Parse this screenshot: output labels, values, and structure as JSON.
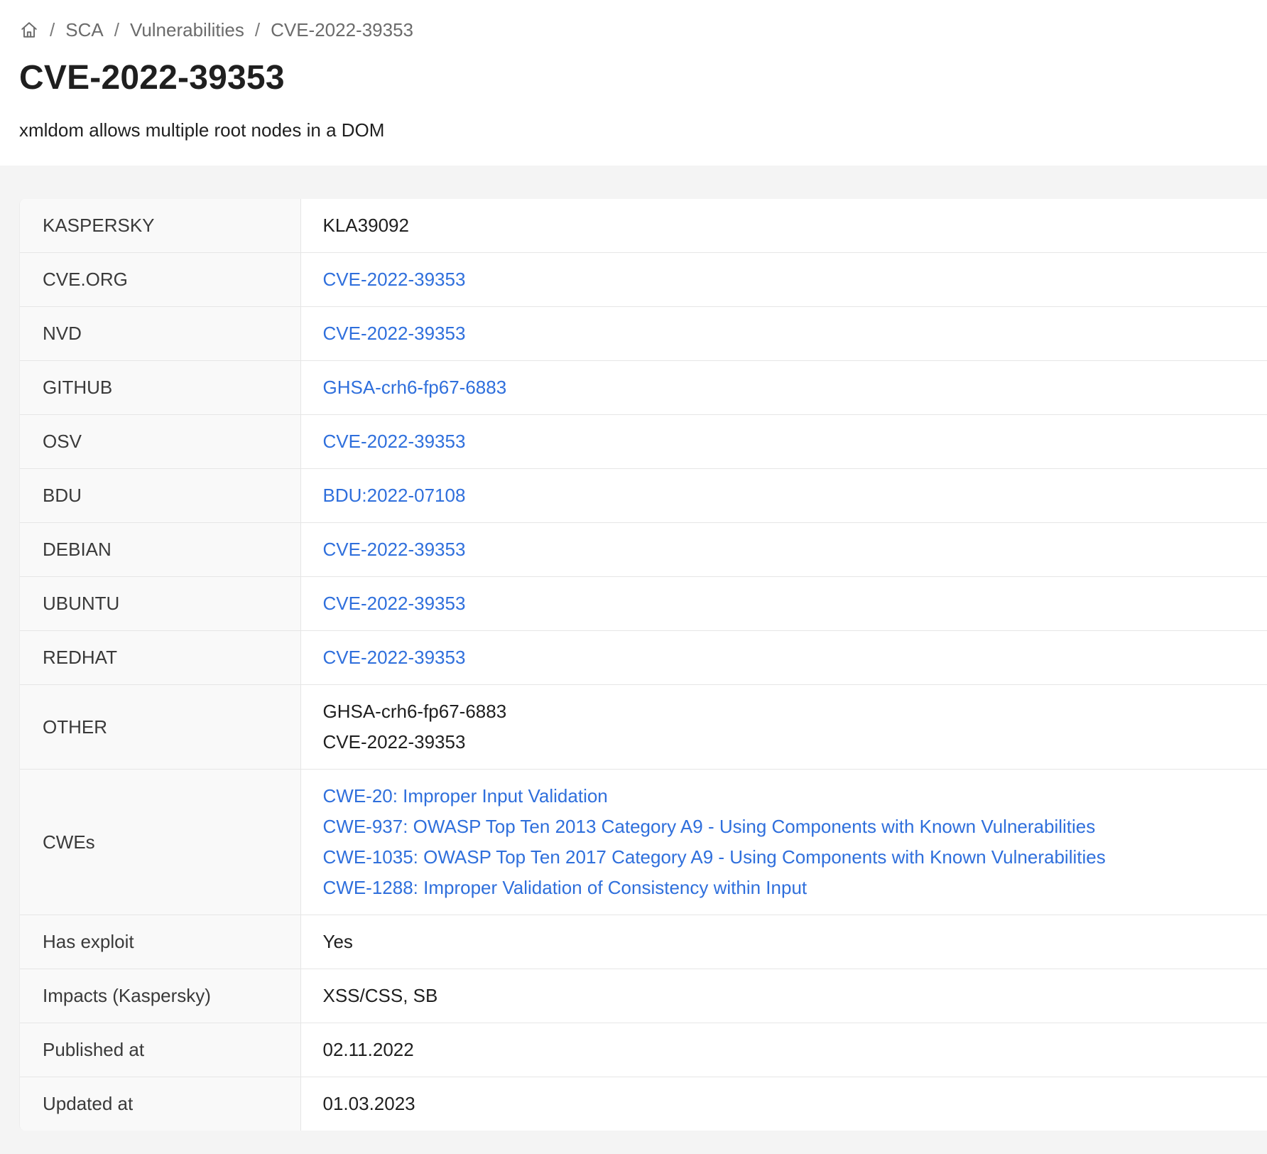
{
  "breadcrumb": {
    "home_icon": "home-icon",
    "items": [
      "SCA",
      "Vulnerabilities",
      "CVE-2022-39353"
    ],
    "separator": "/"
  },
  "title": "CVE-2022-39353",
  "subtitle": "xmldom allows multiple root nodes in a DOM",
  "colors": {
    "link": "#2f6fdc",
    "label_bg": "#f9f9f9",
    "page_bg": "#f4f4f4"
  },
  "rows": {
    "kaspersky": {
      "label": "KASPERSKY",
      "value": "KLA39092"
    },
    "cve_org": {
      "label": "CVE.ORG",
      "value": "CVE-2022-39353"
    },
    "nvd": {
      "label": "NVD",
      "value": "CVE-2022-39353"
    },
    "github": {
      "label": "GITHUB",
      "value": "GHSA-crh6-fp67-6883"
    },
    "osv": {
      "label": "OSV",
      "value": "CVE-2022-39353"
    },
    "bdu": {
      "label": "BDU",
      "value": "BDU:2022-07108"
    },
    "debian": {
      "label": "DEBIAN",
      "value": "CVE-2022-39353"
    },
    "ubuntu": {
      "label": "UBUNTU",
      "value": "CVE-2022-39353"
    },
    "redhat": {
      "label": "REDHAT",
      "value": "CVE-2022-39353"
    },
    "other": {
      "label": "OTHER",
      "values": [
        "GHSA-crh6-fp67-6883",
        "CVE-2022-39353"
      ]
    },
    "cwes": {
      "label": "CWEs",
      "values": [
        "CWE-20: Improper Input Validation",
        "CWE-937: OWASP Top Ten 2013 Category A9 - Using Components with Known Vulnerabilities",
        "CWE-1035: OWASP Top Ten 2017 Category A9 - Using Components with Known Vulnerabilities",
        "CWE-1288: Improper Validation of Consistency within Input"
      ]
    },
    "has_exploit": {
      "label": "Has exploit",
      "value": "Yes"
    },
    "impacts": {
      "label": "Impacts (Kaspersky)",
      "value": "XSS/CSS, SB"
    },
    "published_at": {
      "label": "Published at",
      "value": "02.11.2022"
    },
    "updated_at": {
      "label": "Updated at",
      "value": "01.03.2023"
    }
  }
}
